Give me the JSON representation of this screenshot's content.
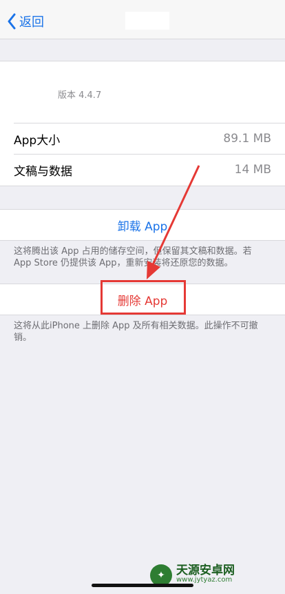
{
  "nav": {
    "back_label": "返回"
  },
  "info": {
    "version_text": "版本 4.4.7",
    "rows": [
      {
        "label": "App大小",
        "value": "89.1 MB"
      },
      {
        "label": "文稿与数据",
        "value": "14 MB"
      }
    ]
  },
  "offload": {
    "button_label": "卸载 App",
    "note": "这将腾出该 App 占用的储存空间，但保留其文稿和数据。若 App Store 仍提供该 App，重新安装将还原您的数据。"
  },
  "delete": {
    "button_label": "删除 App",
    "note": "这将从此iPhone 上删除 App 及所有相关数据。此操作不可撤销。"
  },
  "watermark": {
    "name": "天源安卓网",
    "url": "www.jytyaz.com"
  },
  "colors": {
    "accent": "#1a73e8",
    "destructive": "#e53935",
    "annotation": "#e53935"
  }
}
